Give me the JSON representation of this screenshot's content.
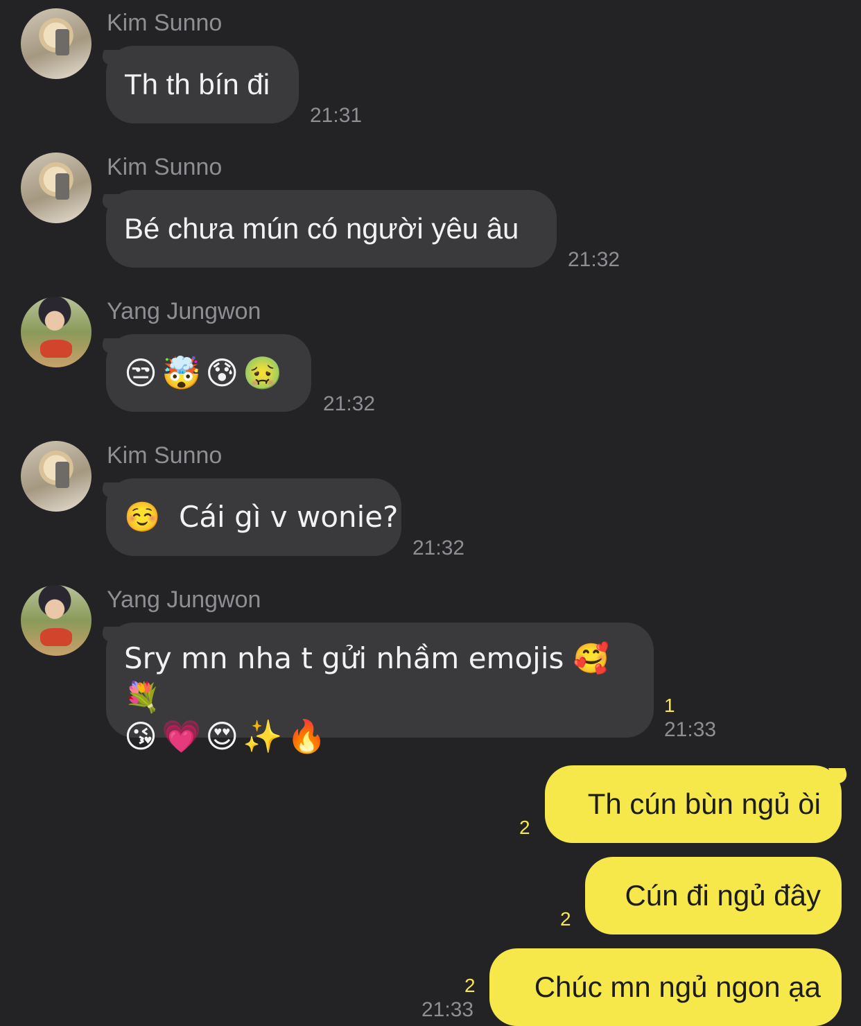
{
  "colors": {
    "background": "#232325",
    "incoming_bubble": "#3a3a3c",
    "outgoing_bubble": "#f6e84a",
    "unread_count": "#f6e84a"
  },
  "messages": [
    {
      "sender": "Kim Sunno",
      "avatar": "kim-sunno-avatar",
      "text": "Th th bín đi",
      "time": "21:31"
    },
    {
      "sender": "Kim Sunno",
      "avatar": "kim-sunno-avatar",
      "text": "Bé chưa mún có người yêu âu",
      "time": "21:32"
    },
    {
      "sender": "Yang Jungwon",
      "avatar": "yang-jungwon-avatar",
      "text": "😒🤯😰🤢",
      "time": "21:32"
    },
    {
      "sender": "Kim Sunno",
      "avatar": "kim-sunno-avatar",
      "text": "☺️  Cái gì v wonie?",
      "time": "21:32"
    },
    {
      "sender": "Yang Jungwon",
      "avatar": "yang-jungwon-avatar",
      "line1": "Sry mn nha t gửi nhầm emojis 🥰💐",
      "line2": "😘💗😍✨🔥",
      "unread": "1",
      "time": "21:33"
    }
  ],
  "outgoing": [
    {
      "text": "Th cún bùn ngủ òi",
      "unread": "2"
    },
    {
      "text": "Cún đi ngủ đây",
      "unread": "2"
    },
    {
      "text": "Chúc mn ngủ ngon ạa",
      "unread": "2",
      "time": "21:33"
    }
  ]
}
